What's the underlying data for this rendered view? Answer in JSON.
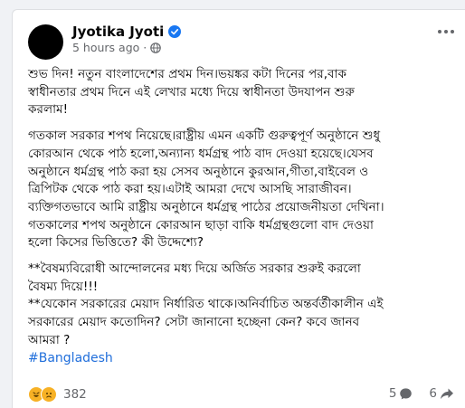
{
  "post": {
    "author": "Jyotika Jyoti",
    "timestamp": "5 hours ago",
    "separator": "·",
    "paragraphs": [
      [
        "শুভ দিন! নতুন বাংলাদেশের প্রথম দিন।ভয়ঙ্কর কটা দিনের পর,বাক",
        "স্বাধীনতার প্রথম দিনে এই লেখার মধ্যে দিয়ে স্বাধীনতা উদযাপন শুরু",
        "করলাম!"
      ],
      [
        "গতকাল সরকার শপথ নিয়েছে।রাষ্ট্রীয় এমন একটি গুরুত্বপূর্ণ অনুষ্ঠানে শুধু",
        "কোরআন থেকে পাঠ হলো,অন্যান্য ধর্মগ্রন্থ পাঠ বাদ দেওয়া হয়েছে।যেসব",
        "অনুষ্ঠানে ধর্মগ্রন্থ পাঠ করা হয় সেসব অনুষ্ঠানে কুরআন,গীতা,বাইবেল ও",
        "ত্রিপিটক থেকে পাঠ করা হয়।এটাই আমরা দেখে আসছি সারাজীবন।",
        "ব্যক্তিগতভাবে আমি রাষ্ট্রীয় অনুষ্ঠানে ধর্মগ্রন্থ পাঠের প্রয়োজনীয়তা দেখিনা।",
        "গতকালের শপথ অনুষ্ঠানে কোরআন ছাড়া বাকি ধর্মগ্রন্থগুলো বাদ দেওয়া",
        "হলো কিসের ভিত্তিতে? কী উদ্দেশ্যে?"
      ],
      [
        "**বৈষম্যবিরোধী আন্দোলনের মধ্য দিয়ে অর্জিত সরকার শুরুই করলো",
        "বৈষম্য দিয়ে!!!",
        "**যেকোন সরকারের মেয়াদ নির্ধারিত থাকে।অনির্বাচিত অন্তর্বর্তীকালীন এই",
        "সরকারের মেয়াদ কতোদিন? সেটা জানানো হচ্ছেনা কেন? কবে জানব",
        "আমরা ?"
      ]
    ],
    "hashtag": "#Bangladesh",
    "reaction_count": "382",
    "reactions": [
      "haha-icon",
      "sad-icon"
    ],
    "comment_count": "5",
    "share_count": "6"
  },
  "colors": {
    "link": "#216fdb",
    "meta": "#65676b",
    "verified": "#1877f2",
    "background": "#f0f2f5"
  }
}
